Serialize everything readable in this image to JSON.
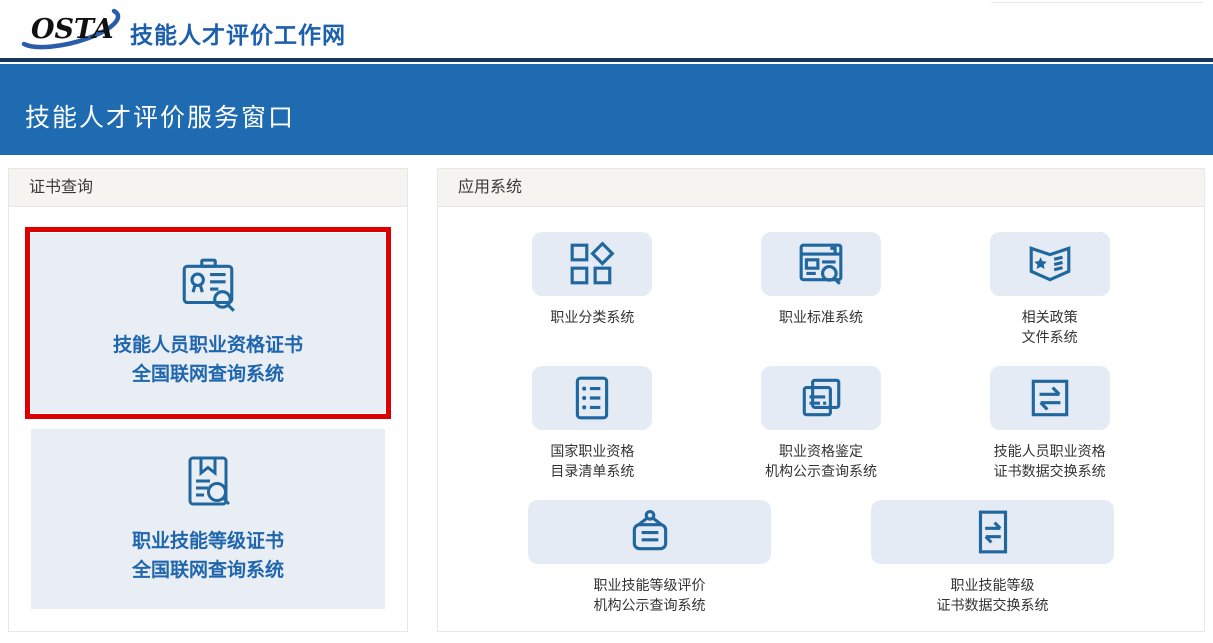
{
  "header": {
    "logo_text": "OSTA",
    "site_title": "技能人才评价工作网"
  },
  "banner": {
    "title": "技能人才评价服务窗口"
  },
  "cert_panel": {
    "header": "证书查询",
    "cards": [
      {
        "line1": "技能人员职业资格证书",
        "line2": "全国联网查询系统",
        "icon": "id-badge-search-icon",
        "highlighted": true
      },
      {
        "line1": "职业技能等级证书",
        "line2": "全国联网查询系统",
        "icon": "certificate-search-icon",
        "highlighted": false
      }
    ]
  },
  "apps_panel": {
    "header": "应用系统",
    "apps": [
      {
        "line1": "职业分类系统",
        "line2": "",
        "icon": "grid-icon"
      },
      {
        "line1": "职业标准系统",
        "line2": "",
        "icon": "browser-search-icon"
      },
      {
        "line1": "相关政策",
        "line2": "文件系统",
        "icon": "book-star-icon"
      },
      {
        "line1": "国家职业资格",
        "line2": "目录清单系统",
        "icon": "list-icon"
      },
      {
        "line1": "职业资格鉴定",
        "line2": "机构公示查询系统",
        "icon": "stacked-pages-icon"
      },
      {
        "line1": "技能人员职业资格",
        "line2": "证书数据交换系统",
        "icon": "data-exchange-icon"
      },
      {
        "line1": "职业技能等级评价",
        "line2": "机构公示查询系统",
        "icon": "placard-icon"
      },
      {
        "line1": "职业技能等级",
        "line2": "证书数据交换系统",
        "icon": "data-exchange-tall-icon"
      }
    ]
  },
  "colors": {
    "banner_blue": "#1e6bb2",
    "banner_dark_line": "#16365c",
    "site_title_blue": "#1c5fad",
    "icon_blue": "#21679f",
    "tile_bg": "#e4ebf4",
    "card_bg": "#e9eef5",
    "card_title_blue": "#2066ad",
    "highlight_red": "#dc0000",
    "panel_header_bg": "#f5f4f1",
    "label_gray": "#333333"
  }
}
